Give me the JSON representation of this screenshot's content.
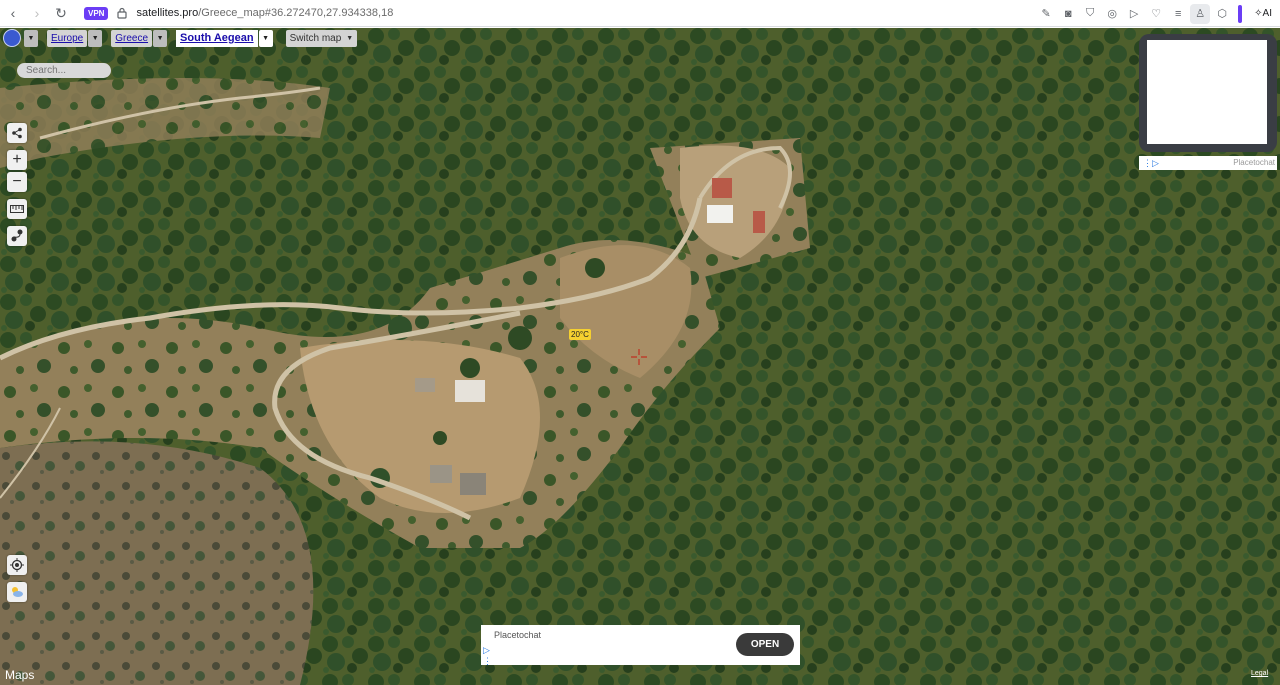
{
  "browser": {
    "back_icon": "chevron-left",
    "forward_icon": "chevron-right",
    "reload_icon": "reload",
    "vpn_label": "VPN",
    "url_domain": "satellites.pro",
    "url_path": "/Greece_map#36.272470,27.934338,18",
    "ai_label": "AI"
  },
  "map_toolbar": {
    "continent": "Europe",
    "country": "Greece",
    "region": "South Aegean",
    "switch_map": "Switch map"
  },
  "search": {
    "placeholder": "Search..."
  },
  "controls": {
    "zoom_in": "+",
    "zoom_out": "−"
  },
  "weather": {
    "temperature": "20°C"
  },
  "ads": {
    "right_brand": "Placetochat",
    "bottom_brand": "Placetochat",
    "open_button": "OPEN"
  },
  "footer": {
    "maps_logo": "Maps",
    "legal": "Legal"
  },
  "colors": {
    "vpn_badge": "#6b3df5",
    "temperature_badge": "#f5d030",
    "link": "#1a0dab"
  }
}
